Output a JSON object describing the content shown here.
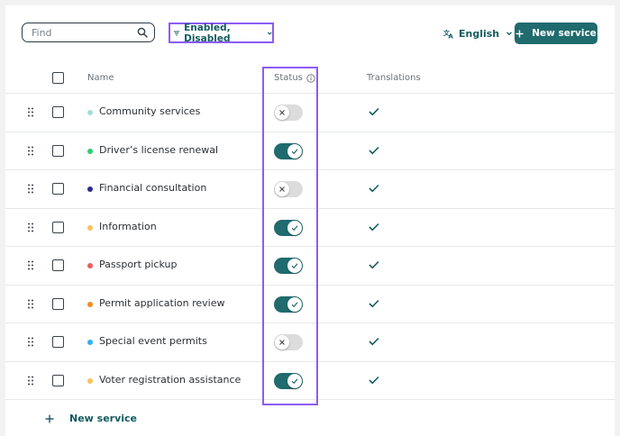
{
  "toolbar": {
    "find_placeholder": "Find",
    "find_value": "",
    "filter_label": "Enabled, Disabled",
    "language_label": "English",
    "new_service_label": "New service"
  },
  "table": {
    "columns": {
      "name": "Name",
      "status": "Status",
      "translations": "Translations"
    },
    "rows": [
      {
        "name": "Community services",
        "dot_color": "#9fe0d8",
        "enabled": false,
        "translated": true
      },
      {
        "name": "Driver’s license renewal",
        "dot_color": "#2ecc71",
        "enabled": true,
        "translated": true
      },
      {
        "name": "Financial consultation",
        "dot_color": "#2b2d8f",
        "enabled": false,
        "translated": true
      },
      {
        "name": "Information",
        "dot_color": "#f7c35c",
        "enabled": true,
        "translated": true
      },
      {
        "name": "Passport pickup",
        "dot_color": "#f05a5a",
        "enabled": true,
        "translated": true
      },
      {
        "name": "Permit application review",
        "dot_color": "#f58a1f",
        "enabled": true,
        "translated": true
      },
      {
        "name": "Special event permits",
        "dot_color": "#2fb0f0",
        "enabled": false,
        "translated": true
      },
      {
        "name": "Voter registration assistance",
        "dot_color": "#f7c35c",
        "enabled": true,
        "translated": true
      }
    ]
  },
  "footer": {
    "add_label": "New service"
  },
  "colors": {
    "accent": "#1f6b6e",
    "highlight": "#8b5cf6"
  }
}
